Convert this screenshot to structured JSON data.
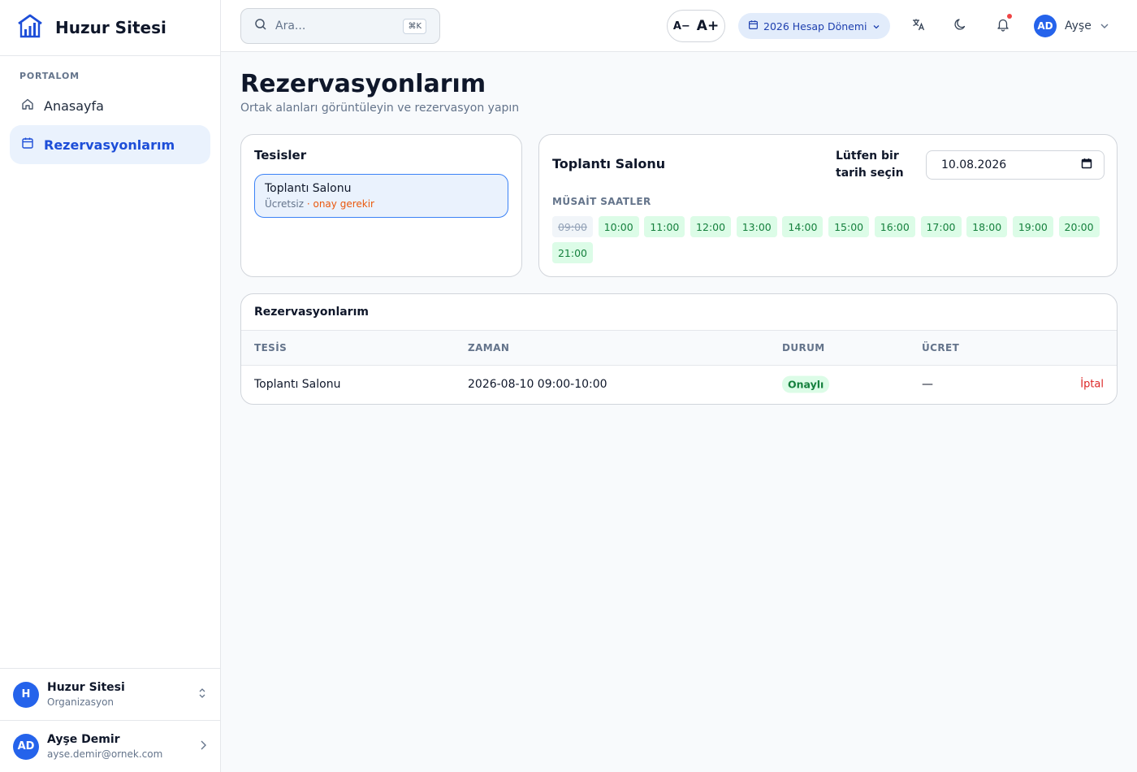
{
  "app": {
    "name": "Huzur Sitesi"
  },
  "sidebar": {
    "section_label": "PORTALOM",
    "items": [
      {
        "label": "Anasayfa",
        "icon": "home-icon"
      },
      {
        "label": "Rezervasyonlarım",
        "icon": "calendar-icon"
      }
    ],
    "org": {
      "avatar": "H",
      "name": "Huzur Sitesi",
      "sub": "Organizasyon"
    },
    "user": {
      "avatar": "AD",
      "name": "Ayşe Demir",
      "email": "ayse.demir@ornek.com"
    }
  },
  "header": {
    "search_placeholder": "Ara...",
    "search_shortcut": "⌘K",
    "font_decrease": "A−",
    "font_increase": "A+",
    "period": "2026 Hesap Dönemi",
    "user_avatar": "AD",
    "user_name": "Ayşe"
  },
  "page": {
    "title": "Rezervasyonlarım",
    "subtitle": "Ortak alanları görüntüleyin ve rezervasyon yapın"
  },
  "facilities": {
    "title": "Tesisler",
    "items": [
      {
        "name": "Toplantı Salonu",
        "price": "Ücretsiz",
        "approval": "· onay gerekir"
      }
    ]
  },
  "detail": {
    "title": "Toplantı Salonu",
    "date_label": "Lütfen bir tarih seçin",
    "date_value": "10.08.2026",
    "slots_label": "MÜSAİT SAATLER",
    "slots": [
      {
        "time": "09:00",
        "available": false
      },
      {
        "time": "10:00",
        "available": true
      },
      {
        "time": "11:00",
        "available": true
      },
      {
        "time": "12:00",
        "available": true
      },
      {
        "time": "13:00",
        "available": true
      },
      {
        "time": "14:00",
        "available": true
      },
      {
        "time": "15:00",
        "available": true
      },
      {
        "time": "16:00",
        "available": true
      },
      {
        "time": "17:00",
        "available": true
      },
      {
        "time": "18:00",
        "available": true
      },
      {
        "time": "19:00",
        "available": true
      },
      {
        "time": "20:00",
        "available": true
      },
      {
        "time": "21:00",
        "available": true
      }
    ]
  },
  "reservations": {
    "title": "Rezervasyonlarım",
    "columns": [
      "TESİS",
      "ZAMAN",
      "DURUM",
      "ÜCRET"
    ],
    "rows": [
      {
        "facility": "Toplantı Salonu",
        "time": "2026-08-10 09:00-10:00",
        "status": "Onaylı",
        "fee": "—",
        "action": "İptal"
      }
    ]
  },
  "colors": {
    "accent": "#2563eb",
    "active_bg": "#eaf2fd",
    "slot_available_bg": "#dcfce7",
    "danger": "#dc2626",
    "warning": "#ea580c"
  }
}
